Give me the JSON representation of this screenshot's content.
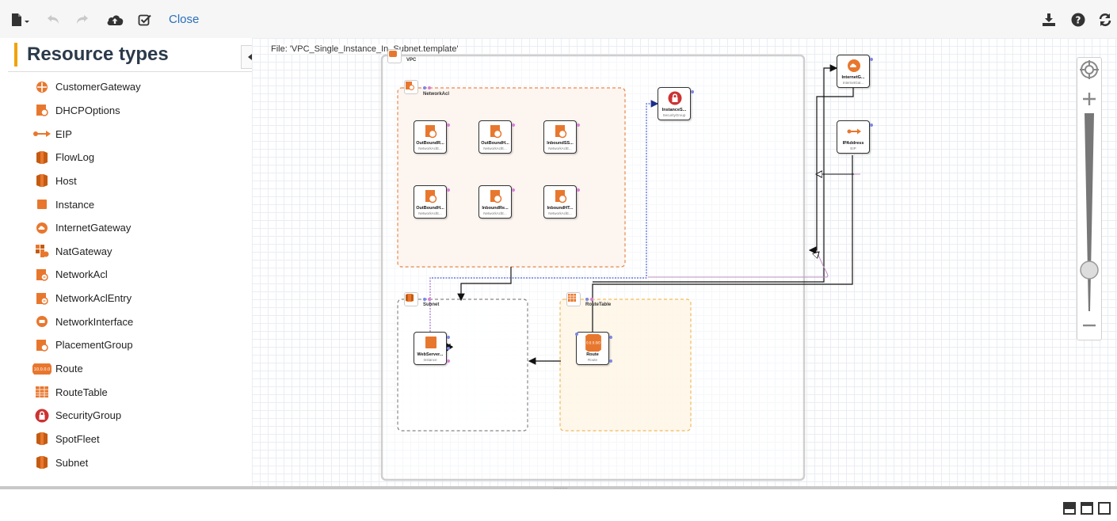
{
  "toolbar": {
    "close_label": "Close"
  },
  "left_panel": {
    "title": "Resource types",
    "items": [
      {
        "label": "CustomerGateway",
        "icon": "customer-gateway-icon"
      },
      {
        "label": "DHCPOptions",
        "icon": "dhcp-options-icon"
      },
      {
        "label": "EIP",
        "icon": "eip-icon"
      },
      {
        "label": "FlowLog",
        "icon": "flowlog-icon"
      },
      {
        "label": "Host",
        "icon": "host-icon"
      },
      {
        "label": "Instance",
        "icon": "instance-icon"
      },
      {
        "label": "InternetGateway",
        "icon": "internet-gateway-icon"
      },
      {
        "label": "NatGateway",
        "icon": "nat-gateway-icon"
      },
      {
        "label": "NetworkAcl",
        "icon": "network-acl-icon"
      },
      {
        "label": "NetworkAclEntry",
        "icon": "network-acl-entry-icon"
      },
      {
        "label": "NetworkInterface",
        "icon": "network-interface-icon"
      },
      {
        "label": "PlacementGroup",
        "icon": "placement-group-icon"
      },
      {
        "label": "Route",
        "icon": "route-icon"
      },
      {
        "label": "RouteTable",
        "icon": "route-table-icon"
      },
      {
        "label": "SecurityGroup",
        "icon": "security-group-icon"
      },
      {
        "label": "SpotFleet",
        "icon": "spot-fleet-icon"
      },
      {
        "label": "Subnet",
        "icon": "subnet-icon"
      }
    ]
  },
  "canvas": {
    "file_label": "File: 'VPC_Single_Instance_In_Subnet.template'",
    "containers": {
      "vpc": "VPC",
      "network_acl": "NetworkAcl",
      "subnet": "Subnet",
      "route_table": "RouteTable"
    },
    "nodes": {
      "acl1": {
        "title": "OutBoundR...",
        "sub": "NetworkAclE..."
      },
      "acl2": {
        "title": "OutBoundH...",
        "sub": "NetworkAclE..."
      },
      "acl3": {
        "title": "InboundSS...",
        "sub": "NetworkAclE..."
      },
      "acl4": {
        "title": "OutBoundH...",
        "sub": "NetworkAclE..."
      },
      "acl5": {
        "title": "InboundRe...",
        "sub": "NetworkAclE..."
      },
      "acl6": {
        "title": "InboundHT...",
        "sub": "NetworkAclE..."
      },
      "sg": {
        "title": "InstanceS...",
        "sub": "SecurityGroup"
      },
      "igw": {
        "title": "InternetG...",
        "sub": "InternetGat..."
      },
      "eip": {
        "title": "IPAddress",
        "sub": "EIP"
      },
      "web": {
        "title": "WebServer...",
        "sub": "Instance"
      },
      "route": {
        "title": "Route",
        "sub": "Route"
      }
    }
  },
  "colors": {
    "accent_orange": "#e8772e",
    "security_red": "#c33",
    "link_blue": "#2a6ebb",
    "title_bar": "#f0a30a"
  }
}
